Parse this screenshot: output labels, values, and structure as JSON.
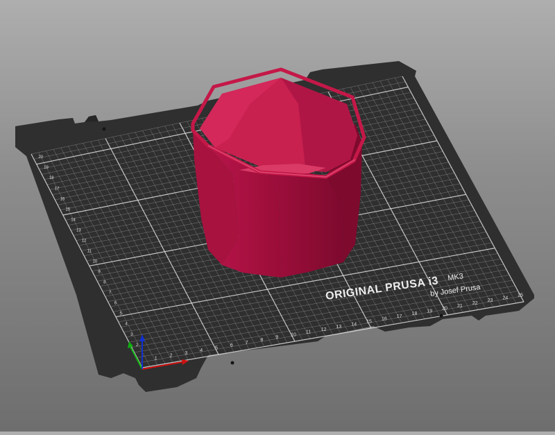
{
  "bed": {
    "brand_line1": "ORIGINAL PRUSA i3",
    "brand_model": "MK3",
    "brand_line2": "by Josef Prusa",
    "x_labels": [
      "1",
      "2",
      "3",
      "4",
      "5",
      "6",
      "7",
      "8",
      "9",
      "10",
      "11",
      "12",
      "13",
      "14",
      "15",
      "16",
      "17",
      "18",
      "19",
      "20",
      "21",
      "22",
      "23",
      "24",
      "25"
    ],
    "y_labels": [
      "1",
      "2",
      "3",
      "4",
      "5",
      "6",
      "7",
      "8",
      "9",
      "10",
      "11",
      "12",
      "13",
      "14",
      "15",
      "16",
      "17",
      "18",
      "19",
      "20"
    ],
    "plate_color": "#2f2f2f",
    "grid_color": "#d8d8d8"
  },
  "model": {
    "name": "octagonal-cup",
    "color": "#a0103a"
  },
  "axes": {
    "x_color": "#d01010",
    "y_color": "#10b010",
    "z_color": "#1030d0"
  }
}
